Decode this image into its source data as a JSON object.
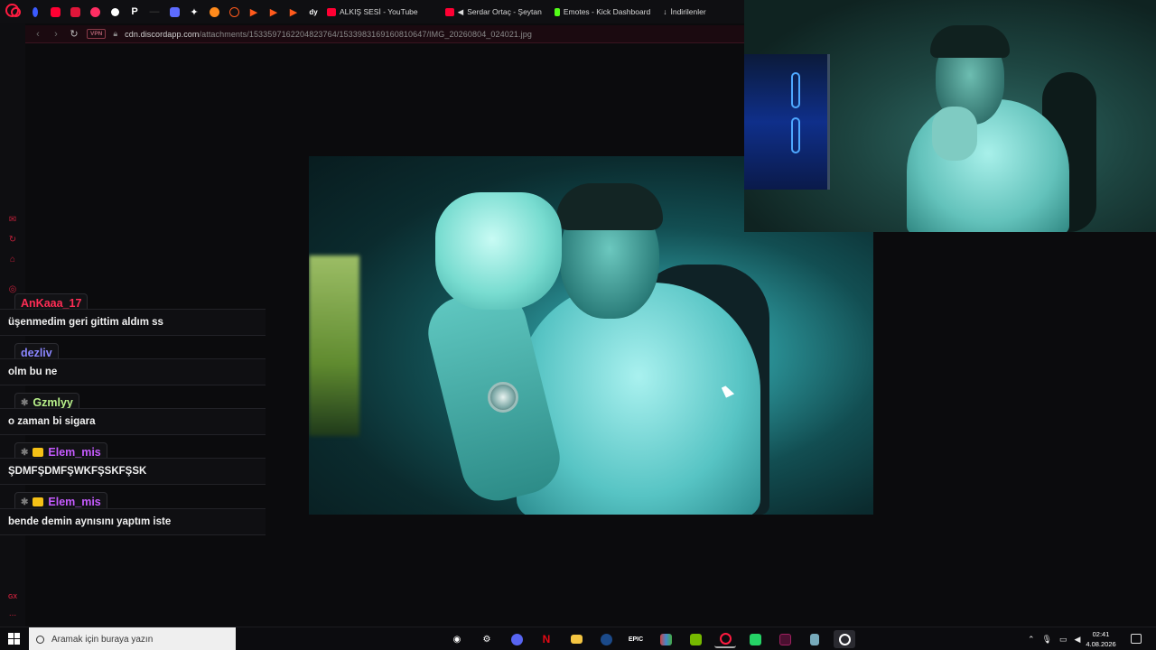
{
  "browser": {
    "bookmarks": [
      {
        "icon": "opera-icon",
        "color": "#ff1b40"
      },
      {
        "icon": "crypto-icon",
        "color": "#3b5bff"
      },
      {
        "icon": "youtube-icon",
        "color": "#ff0033"
      },
      {
        "icon": "app-icon",
        "color": "#e0163a"
      },
      {
        "icon": "app-icon-2",
        "color": "#ff2e63"
      },
      {
        "icon": "github-icon",
        "color": "#ffffff"
      },
      {
        "icon": "p-icon",
        "color": "#ffffff"
      },
      {
        "icon": "divider-icon",
        "color": "#444444"
      },
      {
        "icon": "app-icon-3",
        "color": "#5d6bff"
      },
      {
        "icon": "app-icon-4",
        "color": "#ffffff"
      },
      {
        "icon": "app-icon-5",
        "color": "#ff8a1c"
      },
      {
        "icon": "app-icon-6",
        "color": "#ff5a1c"
      },
      {
        "icon": "app-icon-7",
        "color": "#ff5a1c"
      },
      {
        "icon": "app-icon-8",
        "color": "#ff5a1c"
      },
      {
        "icon": "app-icon-9",
        "color": "#ff5a1c"
      },
      {
        "icon": "app-icon-10",
        "color": "#ffffff"
      }
    ],
    "bookmark_links": [
      {
        "label": "ALKIŞ SESİ - YouTube",
        "color": "#ff0033"
      },
      {
        "label": "Serdar Ortaç - Şeytan",
        "color": "#ff0033"
      },
      {
        "label": "Emotes - Kick Dashboard",
        "color": "#53fc18"
      },
      {
        "label": "İndirilenler",
        "color": "#dddddd"
      }
    ],
    "vpn_label": "VPN",
    "url_domain": "cdn.discordapp.com",
    "url_path": "/attachments/1533597162204823764/1533983169160810647/IMG_20260804_024021.jpg"
  },
  "sidebar": {
    "icons": [
      "mail-icon",
      "refresh-icon",
      "bag-icon",
      "target-icon",
      "gx-icon",
      "more-icon"
    ],
    "gx_label": "GX",
    "more_label": "..."
  },
  "chat": {
    "messages": [
      {
        "user": "AnKaaa_17",
        "user_color": "#ff2d55",
        "badge": "",
        "text": "üşenmedim geri gittim aldım ss"
      },
      {
        "user": "dezliv",
        "user_color": "#8a86ff",
        "badge": "",
        "text": "olm bu ne"
      },
      {
        "user": "Gzmlyy",
        "user_color": "#b8f08a",
        "badge": "star",
        "text": "o zaman bi sigara"
      },
      {
        "user": "Elem_mis",
        "user_color": "#c65bff",
        "badge": "star-crown",
        "text": "ŞDMFŞDMFŞWKFŞSKFŞSK"
      },
      {
        "user": "Elem_mis",
        "user_color": "#c65bff",
        "badge": "star-crown",
        "text": "bende demin aynısını yaptım iste"
      }
    ]
  },
  "taskbar": {
    "search_placeholder": "Aramak için buraya yazın",
    "apps": [
      {
        "icon": "steelseries-icon",
        "color": "#ffffff"
      },
      {
        "icon": "settings-icon",
        "color": "#ffffff"
      },
      {
        "icon": "discord-icon",
        "color": "#5865f2"
      },
      {
        "icon": "netflix-icon",
        "color": "#e50914"
      },
      {
        "icon": "file-explorer-icon",
        "color": "#f4c542"
      },
      {
        "icon": "steam-icon",
        "color": "#c7d5e0"
      },
      {
        "icon": "epic-games-icon",
        "color": "#ffffff"
      },
      {
        "icon": "app-icon-winrar",
        "color": "#d44"
      },
      {
        "icon": "nvidia-icon",
        "color": "#76b900"
      },
      {
        "icon": "opera-gx-icon",
        "color": "#ff1b40"
      },
      {
        "icon": "whatsapp-icon",
        "color": "#25d366"
      },
      {
        "icon": "vegas-icon",
        "color": "#a02060"
      },
      {
        "icon": "notepad-icon",
        "color": "#7ab"
      },
      {
        "icon": "obs-icon",
        "color": "#ffffff"
      }
    ],
    "time": "02:41",
    "date": "4.08.2026"
  }
}
